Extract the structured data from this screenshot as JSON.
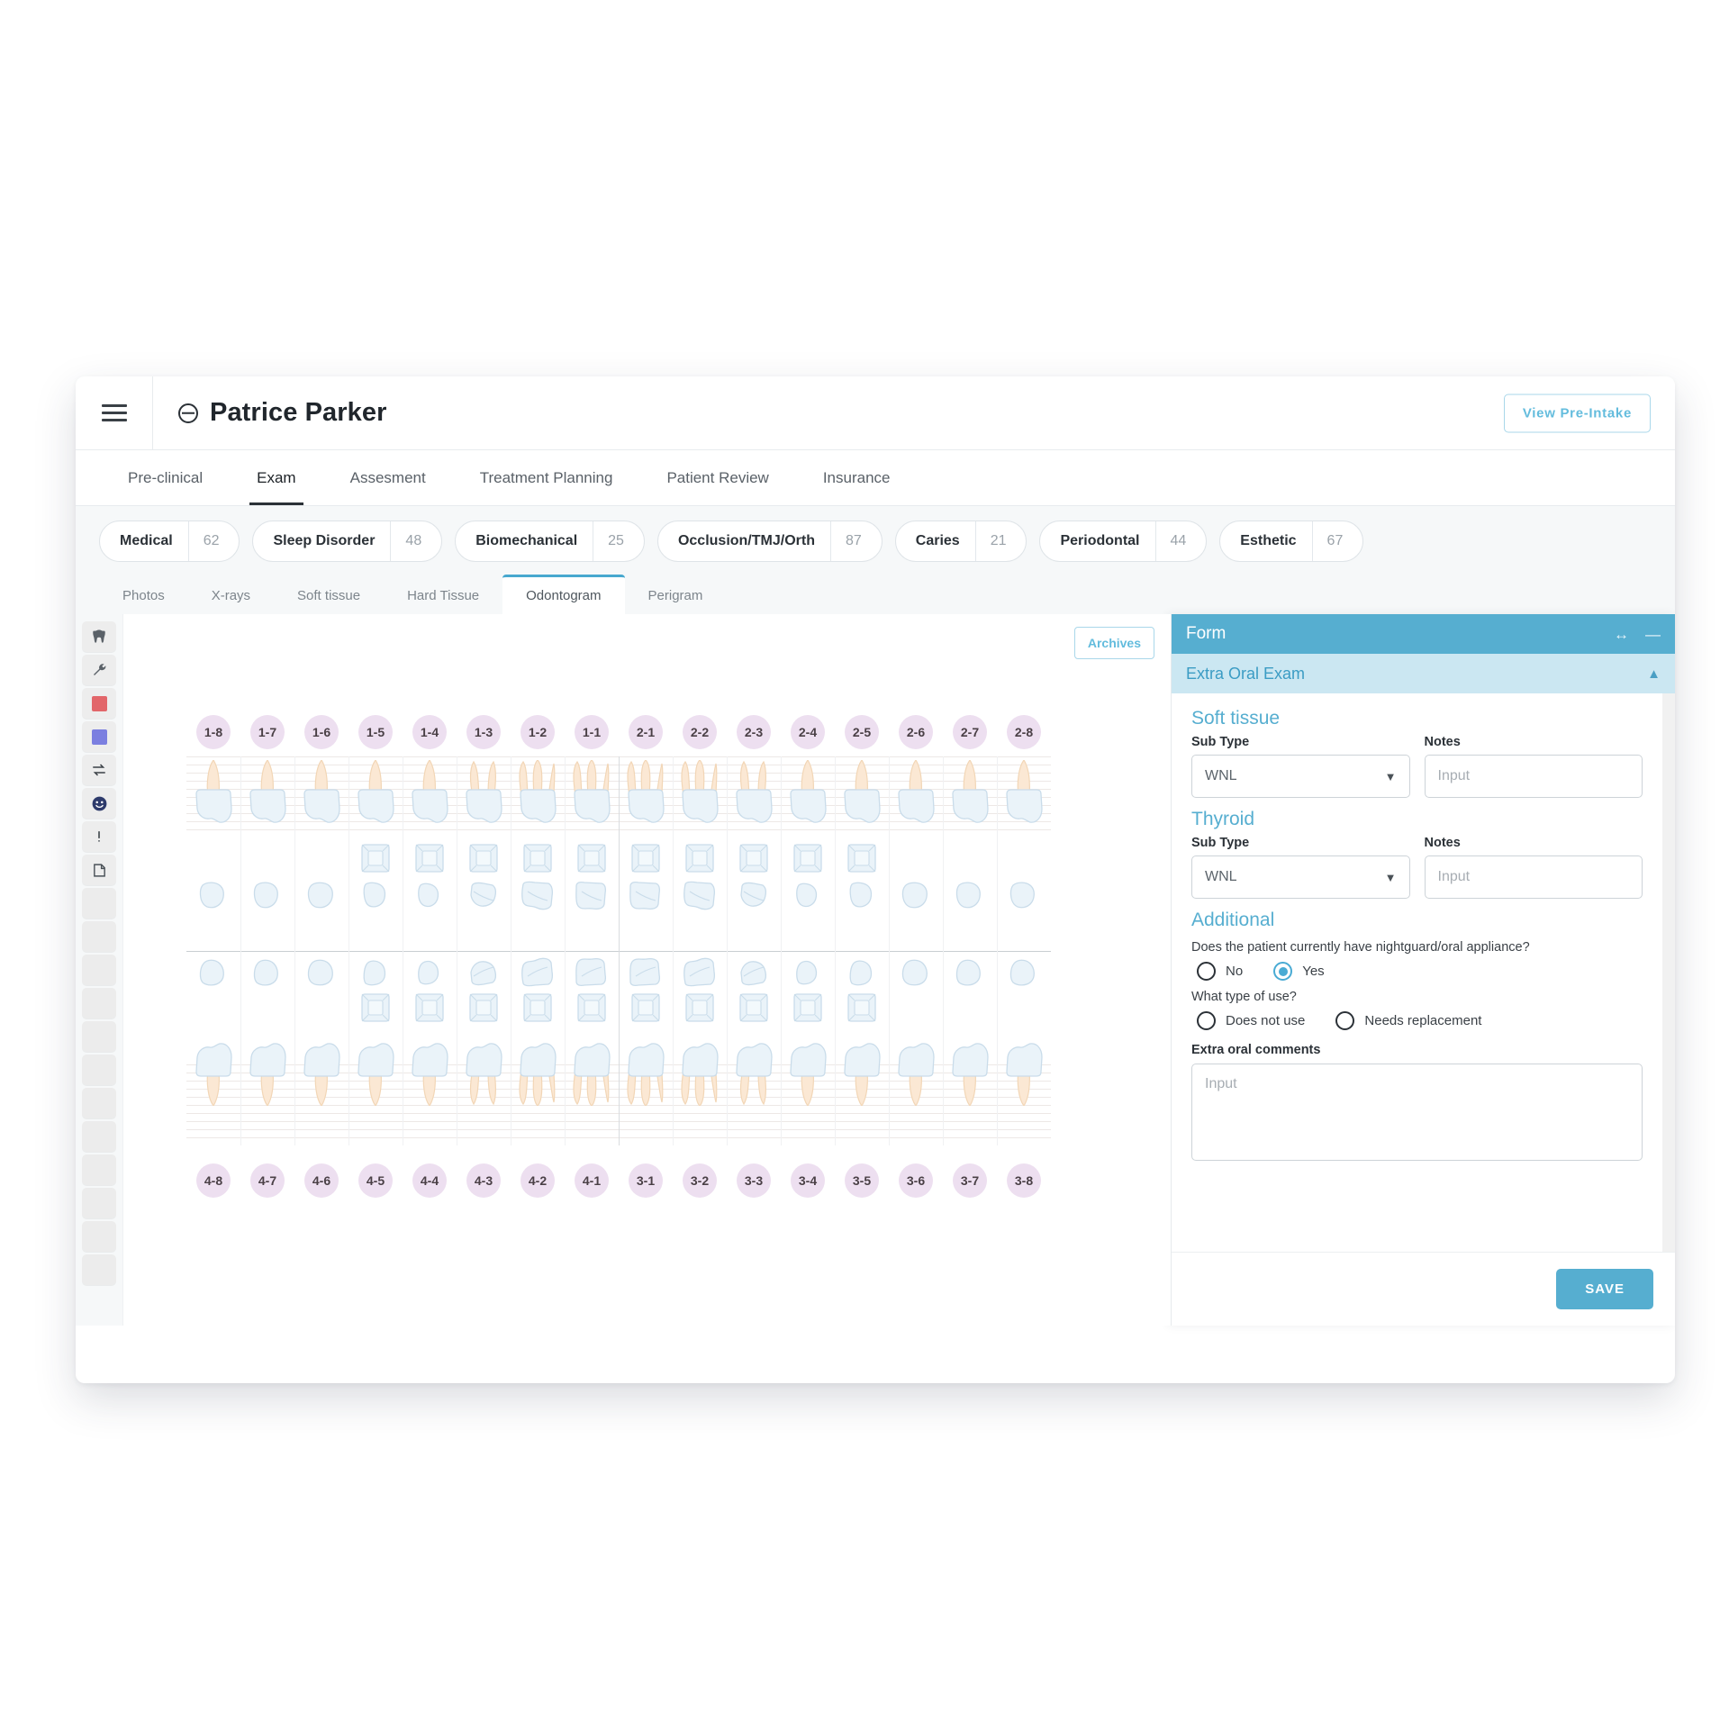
{
  "header": {
    "menu_icon": "hamburger-icon",
    "patient_icon": "user-icon",
    "patient_name": "Patrice Parker",
    "pre_intake_label": "View Pre-Intake"
  },
  "primary_tabs": [
    {
      "label": "Pre-clinical",
      "active": false
    },
    {
      "label": "Exam",
      "active": true
    },
    {
      "label": "Assesment",
      "active": false
    },
    {
      "label": "Treatment Planning",
      "active": false
    },
    {
      "label": "Patient Review",
      "active": false
    },
    {
      "label": "Insurance",
      "active": false
    }
  ],
  "category_chips": [
    {
      "label": "Medical",
      "value": "62"
    },
    {
      "label": "Sleep Disorder",
      "value": "48"
    },
    {
      "label": "Biomechanical",
      "value": "25"
    },
    {
      "label": "Occlusion/TMJ/Orth",
      "value": "87"
    },
    {
      "label": "Caries",
      "value": "21"
    },
    {
      "label": "Periodontal",
      "value": "44"
    },
    {
      "label": "Esthetic",
      "value": "67"
    }
  ],
  "sub_tabs": [
    {
      "label": "Photos",
      "active": false
    },
    {
      "label": "X-rays",
      "active": false
    },
    {
      "label": "Soft tissue",
      "active": false
    },
    {
      "label": "Hard Tissue",
      "active": false
    },
    {
      "label": "Odontogram",
      "active": true
    },
    {
      "label": "Perigram",
      "active": false
    }
  ],
  "toolbar": {
    "icons": [
      "tooth-icon",
      "wrench-icon",
      "red-swatch-icon",
      "blue-swatch-icon",
      "swap-arrows-icon",
      "smiley-face-icon",
      "exclamation-icon",
      "note-icon"
    ],
    "empty_slots": 12
  },
  "odontogram": {
    "archives_label": "Archives",
    "upper_numbers": [
      "1-8",
      "1-7",
      "1-6",
      "1-5",
      "1-4",
      "1-3",
      "1-2",
      "1-1",
      "2-1",
      "2-2",
      "2-3",
      "2-4",
      "2-5",
      "2-6",
      "2-7",
      "2-8"
    ],
    "lower_numbers": [
      "4-8",
      "4-7",
      "4-6",
      "4-5",
      "4-4",
      "4-3",
      "4-2",
      "4-1",
      "3-1",
      "3-2",
      "3-3",
      "3-4",
      "3-5",
      "3-6",
      "3-7",
      "3-8"
    ],
    "chip_bg": "#eddff0",
    "crown_color": "#eaf3f9",
    "root_color": "#fbe8d4"
  },
  "form": {
    "title": "Form",
    "resize_icon": "resize-horizontal-icon",
    "minimize_icon": "minimize-icon",
    "accordion_label": "Extra Oral Exam",
    "accordion_chevron": "chevron-up-icon",
    "accent_color": "#56aed0",
    "sections": [
      {
        "title": "Soft tissue",
        "sub_type_label": "Sub Type",
        "sub_type_value": "WNL",
        "notes_label": "Notes",
        "notes_placeholder": "Input"
      },
      {
        "title": "Thyroid",
        "sub_type_label": "Sub Type",
        "sub_type_value": "WNL",
        "notes_label": "Notes",
        "notes_placeholder": "Input"
      }
    ],
    "additional": {
      "title": "Additional",
      "question_1": "Does the patient currently have nightguard/oral appliance?",
      "options_1": [
        {
          "label": "No",
          "checked": false
        },
        {
          "label": "Yes",
          "checked": true
        }
      ],
      "question_2": "What type of use?",
      "options_2": [
        {
          "label": "Does not use",
          "checked": false
        },
        {
          "label": "Needs replacement",
          "checked": false
        }
      ],
      "comments_label": "Extra oral comments",
      "comments_placeholder": "Input"
    },
    "save_label": "SAVE"
  }
}
